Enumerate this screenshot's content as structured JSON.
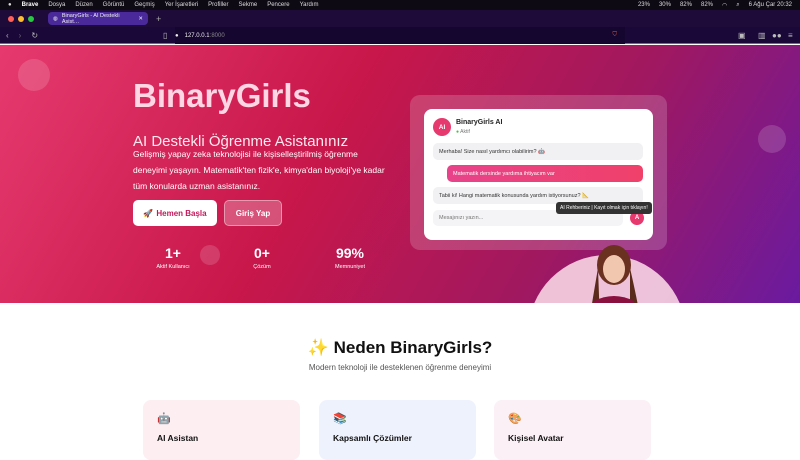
{
  "menubar": {
    "app": "Brave",
    "items": [
      "Dosya",
      "Düzen",
      "Görüntü",
      "Geçmiş",
      "Yer İşaretleri",
      "Profiller",
      "Sekme",
      "Pencere",
      "Yardım"
    ],
    "stats": [
      "23%",
      "30%",
      "82%",
      "82%"
    ],
    "clock": "6 Ağu Çar  20:32"
  },
  "browser": {
    "tab_title": "BinaryGirls - AI Destekli Asist…",
    "url_host": "127.0.0.1",
    "url_port": ":8000"
  },
  "hero": {
    "title": "BinaryGirls",
    "subtitle": "AI Destekli Öğrenme Asistanınız",
    "description": "Gelişmiş yapay zeka teknolojisi ile kişiselleştirilmiş öğrenme deneyimi yaşayın. Matematik'ten fizik'e, kimya'dan biyoloji'ye kadar tüm konularda uzman asistanınız.",
    "primary_button": "Hemen Başla",
    "primary_icon": "🚀",
    "secondary_button": "Giriş Yap",
    "stats": [
      {
        "value": "1+",
        "label": "Aktif Kullanıcı"
      },
      {
        "value": "0+",
        "label": "Çözüm"
      },
      {
        "value": "99%",
        "label": "Memnuniyet"
      }
    ]
  },
  "chat": {
    "avatar": "AI",
    "name": "BinaryGirls AI",
    "status": "Aktif",
    "messages": [
      {
        "from": "bot",
        "text": "Merhaba! Size nasıl yardımcı olabilirim? 🤖"
      },
      {
        "from": "user",
        "text": "Matematik dersinde yardıma ihtiyacım var"
      },
      {
        "from": "bot",
        "text": "Tabii ki! Hangi matematik konusunda yardım istiyorsunuz? 📐"
      }
    ],
    "placeholder": "Mesajınızı yazın...",
    "send_label": "A",
    "tooltip": "AI Rehberiniz | Kayıt olmak için tıklayın!"
  },
  "features": {
    "title": "Neden BinaryGirls?",
    "title_icon": "✨",
    "subtitle": "Modern teknoloji ile desteklenen öğrenme deneyimi",
    "cards": [
      {
        "icon": "🤖",
        "title": "AI Asistan",
        "bg": "#fdeef2"
      },
      {
        "icon": "📚",
        "title": "Kapsamlı Çözümler",
        "bg": "#eef2fd"
      },
      {
        "icon": "🎨",
        "title": "Kişisel Avatar",
        "bg": "#fbf0f6"
      }
    ]
  }
}
